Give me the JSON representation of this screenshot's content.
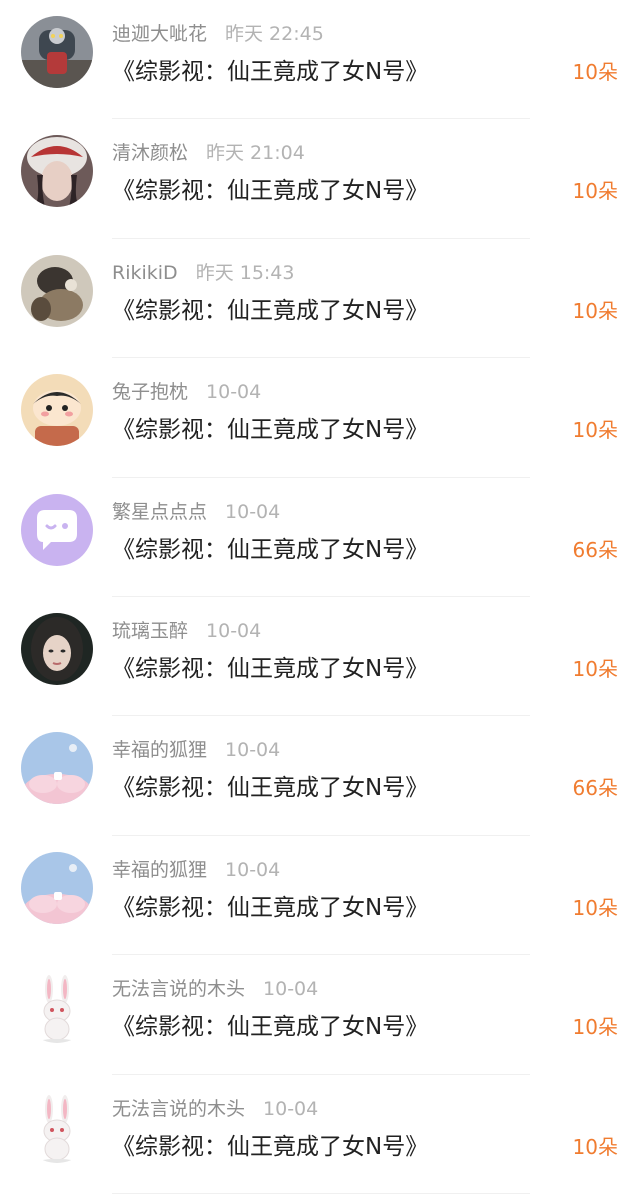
{
  "items": [
    {
      "name": "迪迦大呲花",
      "time": "昨天 22:45",
      "title": "《综影视：仙王竟成了女N号》",
      "gift": "10朵",
      "avatar_icon": "ultraman-avatar-icon"
    },
    {
      "name": "清沐颜松",
      "time": "昨天 21:04",
      "title": "《综影视：仙王竟成了女N号》",
      "gift": "10朵",
      "avatar_icon": "girl-hat-avatar-icon"
    },
    {
      "name": "RikikiD",
      "time": "昨天 15:43",
      "title": "《综影视：仙王竟成了女N号》",
      "gift": "10朵",
      "avatar_icon": "photo-avatar-icon"
    },
    {
      "name": "兔子抱枕",
      "time": "10-04",
      "title": "《综影视：仙王竟成了女N号》",
      "gift": "10朵",
      "avatar_icon": "cartoon-boy-avatar-icon"
    },
    {
      "name": "繁星点点点",
      "time": "10-04",
      "title": "《综影视：仙王竟成了女N号》",
      "gift": "66朵",
      "avatar_icon": "default-chat-avatar-icon"
    },
    {
      "name": "琉璃玉醉",
      "time": "10-04",
      "title": "《综影视：仙王竟成了女N号》",
      "gift": "10朵",
      "avatar_icon": "woman-portrait-avatar-icon"
    },
    {
      "name": "幸福的狐狸",
      "time": "10-04",
      "title": "《综影视：仙王竟成了女N号》",
      "gift": "66朵",
      "avatar_icon": "pink-cloud-avatar-icon"
    },
    {
      "name": "幸福的狐狸",
      "time": "10-04",
      "title": "《综影视：仙王竟成了女N号》",
      "gift": "10朵",
      "avatar_icon": "pink-cloud-avatar-icon"
    },
    {
      "name": "无法言说的木头",
      "time": "10-04",
      "title": "《综影视：仙王竟成了女N号》",
      "gift": "10朵",
      "avatar_icon": "white-rabbit-avatar-icon"
    },
    {
      "name": "无法言说的木头",
      "time": "10-04",
      "title": "《综影视：仙王竟成了女N号》",
      "gift": "10朵",
      "avatar_icon": "white-rabbit-avatar-icon"
    }
  ],
  "colors": {
    "gift_accent": "#f07c30",
    "name_gray": "#8e8e8e",
    "time_gray": "#b3b3b3",
    "title_text": "#222222"
  }
}
